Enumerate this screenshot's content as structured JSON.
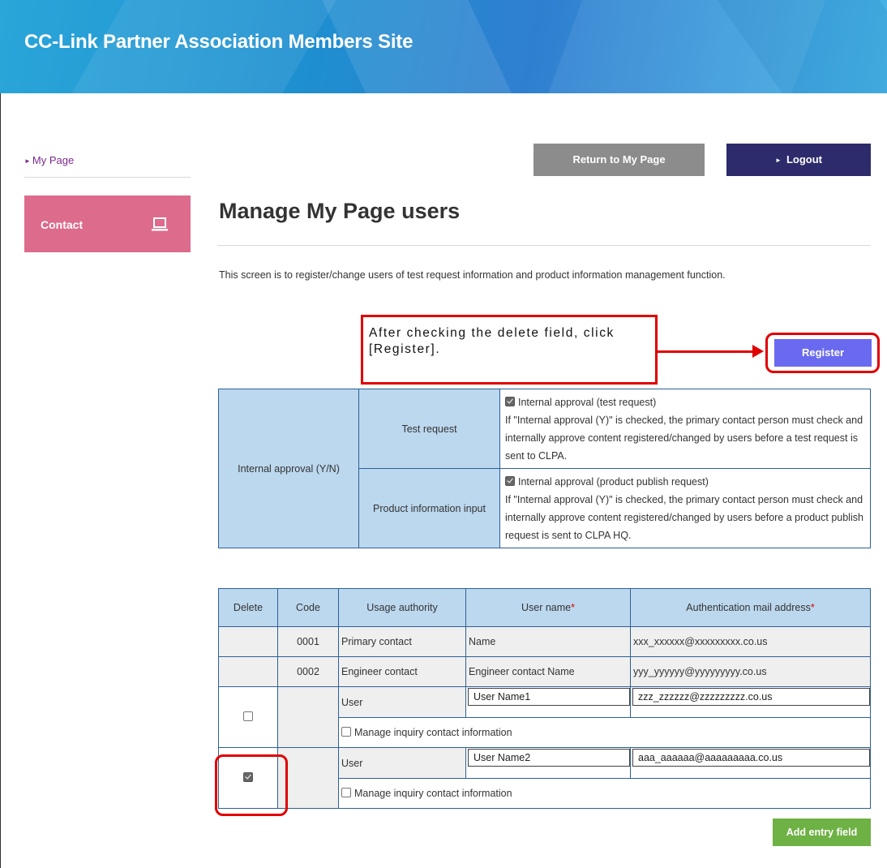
{
  "header": {
    "site_title": "CC-Link Partner Association Members Site"
  },
  "sidebar": {
    "mypage_label": "My Page",
    "contact_label": "Contact",
    "contact_icon": "laptop-icon"
  },
  "toolbar": {
    "return_label": "Return to My Page",
    "logout_label": "Logout"
  },
  "main": {
    "title": "Manage My Page users",
    "intro": "This screen is to register/change users of test request information and product information management function."
  },
  "callout": {
    "text": "After checking the delete field, click [Register]."
  },
  "register_label": "Register",
  "approval": {
    "row_label": "Internal approval (Y/N)",
    "items": [
      {
        "label": "Test request",
        "checkbox_label": "Internal approval (test request)",
        "checked": true,
        "description": "If \"Internal approval (Y)\" is checked, the primary contact person must check and internally approve content registered/changed by users before a test request is sent to CLPA."
      },
      {
        "label": "Product information input",
        "checkbox_label": "Internal approval (product publish request)",
        "checked": true,
        "description": "If \"Internal approval (Y)\" is checked, the primary contact person must check and internally approve content registered/changed by users before a product publish request is sent to CLPA HQ."
      }
    ]
  },
  "users_table": {
    "headers": {
      "delete": "Delete",
      "code": "Code",
      "authority": "Usage authority",
      "user_name": "User name",
      "mail": "Authentication mail address",
      "required_mark": "*"
    },
    "fixed_rows": [
      {
        "code": "0001",
        "authority": "Primary contact",
        "user_name": "Name",
        "mail": "xxx_xxxxxx@xxxxxxxxx.co.us"
      },
      {
        "code": "0002",
        "authority": "Engineer contact",
        "user_name": "Engineer contact Name",
        "mail": "yyy_yyyyyy@yyyyyyyyy.co.us"
      }
    ],
    "user_rows": [
      {
        "delete_checked": false,
        "authority": "User",
        "user_name": "User Name1",
        "mail": "zzz_zzzzzz@zzzzzzzzz.co.us",
        "manage_label": "Manage inquiry contact information",
        "manage_checked": false
      },
      {
        "delete_checked": true,
        "authority": "User",
        "user_name": "User Name2",
        "mail": "aaa_aaaaaa@aaaaaaaaa.co.us",
        "manage_label": "Manage inquiry contact information",
        "manage_checked": false
      }
    ]
  },
  "add_entry_label": "Add entry field",
  "colors": {
    "banner": "#1e8fd0",
    "contact": "#dc6b8c",
    "return": "#8c8c8c",
    "logout": "#2d2b6b",
    "register": "#6a6af0",
    "add_entry": "#6eb144",
    "highlight": "#e00000",
    "table_header": "#bcd8ee"
  }
}
